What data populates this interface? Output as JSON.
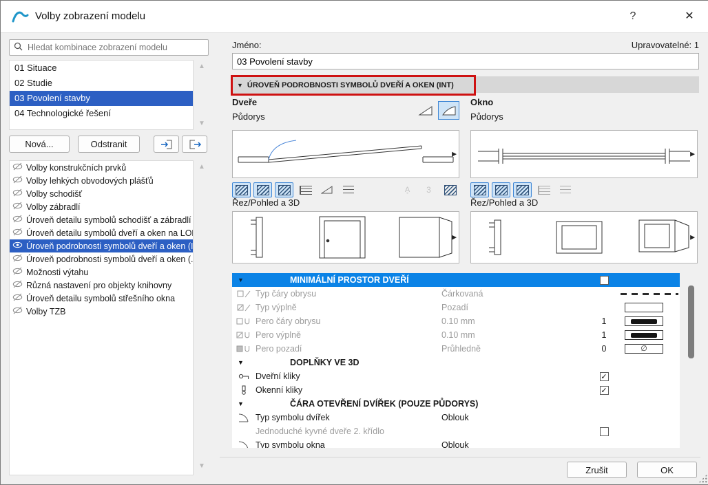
{
  "window": {
    "title": "Volby zobrazení modelu",
    "help_label": "?",
    "close_label": "✕"
  },
  "icons": {
    "scroll_up": "▲",
    "scroll_down": "▼",
    "collapse": "▼",
    "preview_next": "▶",
    "check": "✓",
    "empty_set": "∅",
    "text_marker": "Ḁ"
  },
  "sidebar": {
    "search_placeholder": "Hledat kombinace zobrazení modelu",
    "combinations": [
      "01 Situace",
      "02 Studie",
      "03 Povolení stavby",
      "04 Technologické řešení"
    ],
    "selected_combination": "03 Povolení stavby",
    "new_button": "Nová...",
    "delete_button": "Odstranit",
    "options": [
      "Volby konstrukčních prvků",
      "Volby lehkých obvodových plášťů",
      "Volby schodišť",
      "Volby zábradlí",
      "Úroveň detailu symbolů schodišť a zábradlí",
      "Úroveň detailu symbolů dveří a oken na LOPu",
      "Úroveň podrobnosti symbolů dveří a oken (I...",
      "Úroveň podrobnosti symbolů dveří a oken (...",
      "Možnosti výtahu",
      "Různá nastavení pro objekty knihovny",
      "Úroveň detailu symbolů střešního okna",
      "Volby TZB"
    ],
    "selected_option": "Úroveň podrobnosti symbolů dveří a oken (I..."
  },
  "main": {
    "name_label": "Jméno:",
    "editable_label": "Upravovatelné: 1",
    "name_value": "03 Povolení stavby",
    "section_title": "ÚROVEŇ PODROBNOSTI SYMBOLŮ DVEŘÍ A OKEN (INT)",
    "door": {
      "title": "Dveře",
      "plan_label": "Půdorys",
      "section3d_label": "Řez/Pohled a 3D",
      "badge_3": "3"
    },
    "window_col": {
      "title": "Okno",
      "plan_label": "Půdorys",
      "section3d_label": "Řez/Pohled a 3D"
    },
    "table": {
      "groups": [
        {
          "title": "MINIMÁLNÍ PROSTOR DVEŘÍ",
          "checked": false,
          "rows": [
            {
              "label": "Typ čáry obrysu",
              "value": "Čárkovaná"
            },
            {
              "label": "Typ výplně",
              "value": "Pozadí"
            },
            {
              "label": "Pero čáry obrysu",
              "value": "0.10 mm",
              "number": "1"
            },
            {
              "label": "Pero výplně",
              "value": "0.10 mm",
              "number": "1"
            },
            {
              "label": "Pero pozadí",
              "value": "Průhledně",
              "number": "0"
            }
          ]
        },
        {
          "title": "DOPLŇKY VE 3D",
          "rows": [
            {
              "label": "Dveřní kliky",
              "checked": true
            },
            {
              "label": "Okenní kliky",
              "checked": true
            }
          ]
        },
        {
          "title": "ČÁRA OTEVŘENÍ DVÍŘEK (POUZE PŮDORYS)",
          "rows": [
            {
              "label": "Typ symbolu dvířek",
              "value": "Oblouk"
            },
            {
              "label": "Jednoduché kyvné dveře 2. křídlo",
              "checked": false
            },
            {
              "label": "Typ symbolu okna",
              "value": "Oblouk"
            }
          ]
        }
      ]
    },
    "cancel_button": "Zrušit",
    "ok_button": "OK"
  }
}
